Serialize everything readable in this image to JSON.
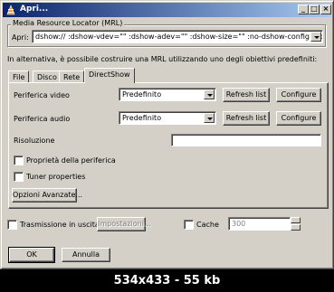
{
  "window": {
    "title": "Apri..."
  },
  "title_buttons": {
    "minimize": "_",
    "maximize": "□",
    "close": "×"
  },
  "mrl": {
    "group_label": "Media Resource Locator (MRL)",
    "open_label": "Apri:",
    "value": "dshow:// :dshow-vdev=\"\" :dshow-adev=\"\" :dshow-size=\"\" :no-dshow-config :no-dshow-tuner"
  },
  "hint": "In alternativa, è possibile costruire una MRL utilizzando uno degli obiettivi predefiniti:",
  "tabs": [
    {
      "label": "File"
    },
    {
      "label": "Disco"
    },
    {
      "label": "Rete"
    },
    {
      "label": "DirectShow"
    }
  ],
  "directshow": {
    "video_label": "Periferica video",
    "video_value": "Predefinito",
    "audio_label": "Periferica audio",
    "audio_value": "Predefinito",
    "refresh_label": "Refresh list",
    "configure_label": "Configure",
    "resolution_label": "Risoluzione",
    "resolution_value": "",
    "device_props_label": "Proprietà della periferica",
    "tuner_props_label": "Tuner properties",
    "advanced_label": "Opzioni Avanzate..."
  },
  "bottom": {
    "stream_label": "Trasmissione in uscita",
    "settings_label": "Impostazioni...",
    "cache_label": "Cache",
    "cache_value": "300",
    "ok_label": "OK",
    "cancel_label": "Annulla"
  },
  "footer": {
    "text": "534x433 - 55 kb"
  },
  "colors": {
    "face": "#d4d0c8",
    "title_start": "#0a246a",
    "title_end": "#a6caf0"
  }
}
